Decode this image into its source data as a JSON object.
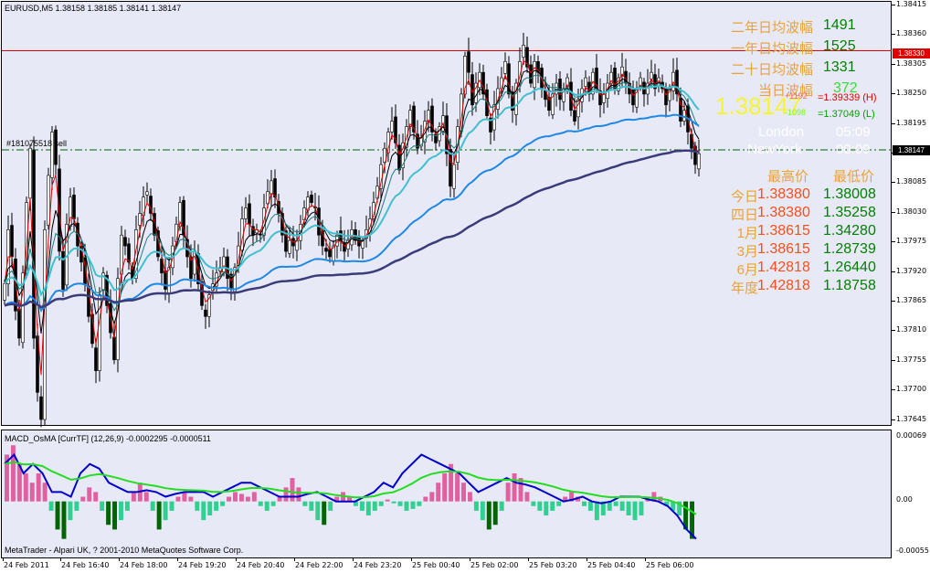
{
  "symbol_header": "EURUSD,M5  1.38158 1.38185 1.38141 1.38147",
  "order_label": "#181075518 sell",
  "macd_header": "MACD_OsMA [CurrTF] (12,26,9) -0.0002295 -0.0000511",
  "copyright": "MetaTrader - Alpari UK, ? 2001-2010 MetaQuotes Software Corp.",
  "current_price_tag": "1.38147",
  "red_line_tag": "1.38330",
  "wave_stats": [
    {
      "label": "二年日均波幅",
      "value": "1491"
    },
    {
      "label": "一年日均波幅",
      "value": "1525"
    },
    {
      "label": "二十日均波幅",
      "value": "1331"
    },
    {
      "label": "当日波幅",
      "value": "372"
    }
  ],
  "big_price": "1.38147",
  "big_price_up": "+1192",
  "big_price_down": "-1098",
  "high_line": "=1.39339 (H)",
  "low_line": "=1.37049 (L)",
  "sessions": [
    {
      "name": "London",
      "time": "05:09"
    },
    {
      "name": "NewYork",
      "time": "00:09"
    }
  ],
  "range_header": {
    "high": "最高价",
    "low": "最低价"
  },
  "ranges": [
    {
      "label": "今日",
      "high": "1.38380",
      "low": "1.38008"
    },
    {
      "label": "四日",
      "high": "1.38380",
      "low": "1.35258"
    },
    {
      "label": "1月",
      "high": "1.38615",
      "low": "1.34280"
    },
    {
      "label": "3月",
      "high": "1.38615",
      "low": "1.28739"
    },
    {
      "label": "6月",
      "high": "1.42818",
      "low": "1.26440"
    },
    {
      "label": "年度",
      "high": "1.42818",
      "low": "1.18758"
    }
  ],
  "price_axis": [
    "1.38415",
    "1.38360",
    "1.38305",
    "1.38250",
    "1.38195",
    "1.38140",
    "1.38085",
    "1.38030",
    "1.37975",
    "1.37920",
    "1.37865",
    "1.37810",
    "1.37755",
    "1.37700",
    "1.37645"
  ],
  "macd_axis": [
    "0.00069",
    "0.00",
    "-0.00055"
  ],
  "time_axis": [
    "24 Feb 2011",
    "24 Feb 16:40",
    "24 Feb 18:00",
    "24 Feb 19:20",
    "24 Feb 20:40",
    "24 Feb 22:00",
    "24 Feb 23:20",
    "25 Feb 00:40",
    "25 Feb 02:00",
    "25 Feb 03:20",
    "25 Feb 04:40",
    "25 Feb 06:00"
  ],
  "colors": {
    "background": "#e8e9f7",
    "bull_candle": "#ffffff",
    "bear_candle": "#000000",
    "ma_fast": "#e00000",
    "ma_black": "#000000",
    "ma_teal": "#1a8080",
    "ma_cyan": "#40c0d0",
    "ma_blue": "#1e88e5",
    "ma_slow": "#3b3b7a",
    "red_hline": "#e00000",
    "green_dash": "#006400",
    "macd_line": "#0000cc",
    "signal_line": "#22dd22",
    "hist_pos": "#e060a0",
    "hist_neg_light": "#30d090",
    "hist_neg_dark": "#006400"
  },
  "chart_data": {
    "type": "candlestick",
    "symbol": "EURUSD",
    "timeframe": "M5",
    "ylim": [
      1.37645,
      1.38415
    ],
    "closes": [
      1.379,
      1.38,
      1.3795,
      1.3785,
      1.378,
      1.3792,
      1.3805,
      1.3815,
      1.378,
      1.377,
      1.3765,
      1.38,
      1.381,
      1.3818,
      1.3812,
      1.3796,
      1.3789,
      1.3801,
      1.3806,
      1.3802,
      1.3797,
      1.3794,
      1.379,
      1.3784,
      1.3779,
      1.3774,
      1.3788,
      1.3792,
      1.3786,
      1.3781,
      1.3776,
      1.3791,
      1.3799,
      1.3797,
      1.3794,
      1.3791,
      1.38,
      1.3803,
      1.3806,
      1.3807,
      1.3803,
      1.3799,
      1.3795,
      1.3792,
      1.3789,
      1.3793,
      1.3797,
      1.3801,
      1.3805,
      1.3799,
      1.3795,
      1.3791,
      1.3796,
      1.379,
      1.3786,
      1.3784,
      1.3788,
      1.379,
      1.3792,
      1.3793,
      1.3795,
      1.3791,
      1.3789,
      1.3793,
      1.3797,
      1.3802,
      1.3804,
      1.3801,
      1.3799,
      1.38,
      1.3799,
      1.3804,
      1.3807,
      1.3809,
      1.3806,
      1.3803,
      1.3799,
      1.3796,
      1.3798,
      1.3797,
      1.3798,
      1.3801,
      1.3804,
      1.3806,
      1.3805,
      1.3804,
      1.3799,
      1.3797,
      1.3796,
      1.3795,
      1.3797,
      1.3799,
      1.3798,
      1.3796,
      1.3798,
      1.38,
      1.3798,
      1.3797,
      1.3798,
      1.38,
      1.3802,
      1.3805,
      1.3808,
      1.3812,
      1.3815,
      1.3818,
      1.382,
      1.3816,
      1.3811,
      1.3816,
      1.3819,
      1.3822,
      1.3818,
      1.3815,
      1.3817,
      1.382,
      1.3822,
      1.3818,
      1.3816,
      1.3819,
      1.3821,
      1.3814,
      1.3808,
      1.3812,
      1.3819,
      1.3825,
      1.3832,
      1.3829,
      1.3823,
      1.3827,
      1.3829,
      1.3825,
      1.3821,
      1.3818,
      1.3823,
      1.3826,
      1.3828,
      1.3831,
      1.3825,
      1.3822,
      1.3827,
      1.3831,
      1.3834,
      1.383,
      1.3827,
      1.3831,
      1.3829,
      1.3826,
      1.3824,
      1.3822,
      1.3825,
      1.3827,
      1.3824,
      1.3826,
      1.3828,
      1.3822,
      1.382,
      1.3824,
      1.3826,
      1.3828,
      1.3825,
      1.3829,
      1.3826,
      1.3823,
      1.3825,
      1.3827,
      1.3829,
      1.3826,
      1.3828,
      1.383,
      1.3827,
      1.3825,
      1.3823,
      1.3826,
      1.3828,
      1.3825,
      1.3827,
      1.3829,
      1.3826,
      1.3828,
      1.3826,
      1.3823,
      1.3826,
      1.3829,
      1.3825,
      1.382,
      1.3822,
      1.3818,
      1.3815,
      1.3812,
      1.3814
    ]
  },
  "macd_data": {
    "ylim": [
      -0.00055,
      0.00069
    ],
    "histogram": [
      0.0005,
      0.0006,
      0.0004,
      0.0003,
      0.0002,
      0.0003,
      0.0002,
      -0.0001,
      -0.0003,
      -0.0004,
      -0.0002,
      -0.0001,
      5e-05,
      0.00015,
      0.0001,
      -0.0001,
      -0.00025,
      -0.0003,
      -0.0002,
      -0.0001,
      0.0001,
      0.0002,
      0.0001,
      -0.0001,
      -0.0003,
      -0.0002,
      -0.0001,
      5e-05,
      0.0001,
      5e-05,
      -0.0001,
      -0.0002,
      -0.00015,
      -0.0001,
      -5e-05,
      5e-05,
      0.0001,
      8e-05,
      5e-05,
      0.0001,
      -5e-05,
      -0.0001,
      -5e-05,
      5e-05,
      0.00015,
      0.00025,
      0.00015,
      -5e-05,
      -0.0001,
      -0.0002,
      -0.00025,
      -0.0001,
      5e-05,
      0.0001,
      5e-05,
      -5e-05,
      -0.0001,
      -0.00015,
      -0.0001,
      -5e-05,
      2e-05,
      -2e-05,
      -5e-05,
      -0.0001,
      -8e-05,
      -5e-05,
      5e-05,
      0.0001,
      0.0002,
      0.0003,
      0.0004,
      0.0003,
      0.0002,
      0.0001,
      -0.0001,
      -0.0002,
      -0.0003,
      -0.00025,
      -0.0001,
      0.0002,
      0.0003,
      0.00025,
      0.0001,
      -5e-05,
      -0.0001,
      -0.00015,
      -0.0001,
      -5e-05,
      5e-05,
      0.0001,
      5e-05,
      -5e-05,
      -0.0001,
      -0.0002,
      -0.00015,
      -0.0001,
      -5e-05,
      -0.0001,
      -0.00015,
      -0.0002,
      -0.00015,
      5e-05,
      0.0001,
      5e-05,
      -5e-05,
      -0.0001,
      -0.00015,
      -0.0003,
      -0.0004
    ],
    "macd_line": [
      0.0004,
      0.0005,
      0.0003,
      0.0004,
      0.0003,
      0.0001,
      0.0001,
      5e-05,
      0.0003,
      0.0004,
      0.00035,
      0.0002,
      0.00015,
      0.0001,
      0.0001,
      0.00012,
      0.0001,
      5e-05,
      8e-05,
      0.0001,
      0.0001,
      0.0001,
      5e-05,
      0.0001,
      0.00015,
      0.0002,
      0.0002,
      0.00015,
      0.0001,
      5e-05,
      5e-05,
      5e-05,
      8e-05,
      0.0001,
      5e-05,
      0.0,
      0.0,
      0.0,
      5e-05,
      0.0001,
      0.0002,
      0.00015,
      0.0003,
      0.0004,
      0.0005,
      0.00045,
      0.0004,
      0.00035,
      0.0003,
      0.0002,
      0.0001,
      0.00015,
      0.0002,
      0.00025,
      0.0002,
      0.00018,
      0.00015,
      0.0001,
      5e-05,
      0.0,
      2e-05,
      5e-05,
      0.0,
      -2e-05,
      0.0,
      5e-05,
      5e-05,
      5e-05,
      2e-05,
      0.0,
      -5e-05,
      -0.00015,
      -0.0003,
      -0.0004
    ]
  }
}
